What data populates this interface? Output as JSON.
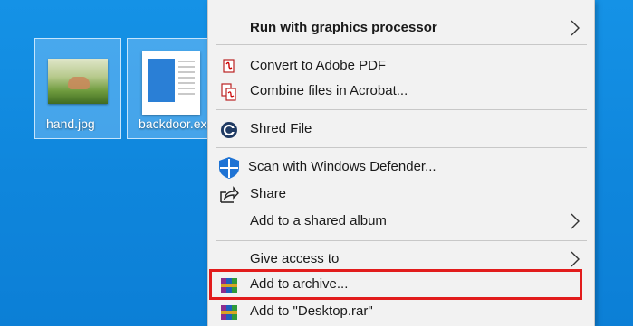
{
  "desktop": {
    "icons": [
      {
        "label": "hand.jpg"
      },
      {
        "label": "backdoor.exe"
      }
    ]
  },
  "context_menu": {
    "items": [
      {
        "label": "Run with graphics processor",
        "submenu": true,
        "bold": true,
        "icon": ""
      },
      {
        "label": "Convert to Adobe PDF",
        "icon": "acrobat-convert-icon"
      },
      {
        "label": "Combine files in Acrobat...",
        "icon": "acrobat-combine-icon"
      },
      {
        "label": "Shred File",
        "icon": "shred-icon"
      },
      {
        "label": "Scan with Windows Defender...",
        "icon": "windows-defender-icon"
      },
      {
        "label": "Share",
        "icon": "share-icon"
      },
      {
        "label": "Add to a shared album",
        "submenu": true,
        "icon": ""
      },
      {
        "label": "Give access to",
        "submenu": true,
        "icon": ""
      },
      {
        "label": "Add to archive...",
        "icon": "winrar-icon",
        "highlighted": true
      },
      {
        "label": "Add to \"Desktop.rar\"",
        "icon": "winrar-icon"
      }
    ]
  },
  "colors": {
    "desktop_blue": "#0f86dc",
    "menu_bg": "#f2f2f2",
    "highlight_red": "#e21c1c"
  }
}
